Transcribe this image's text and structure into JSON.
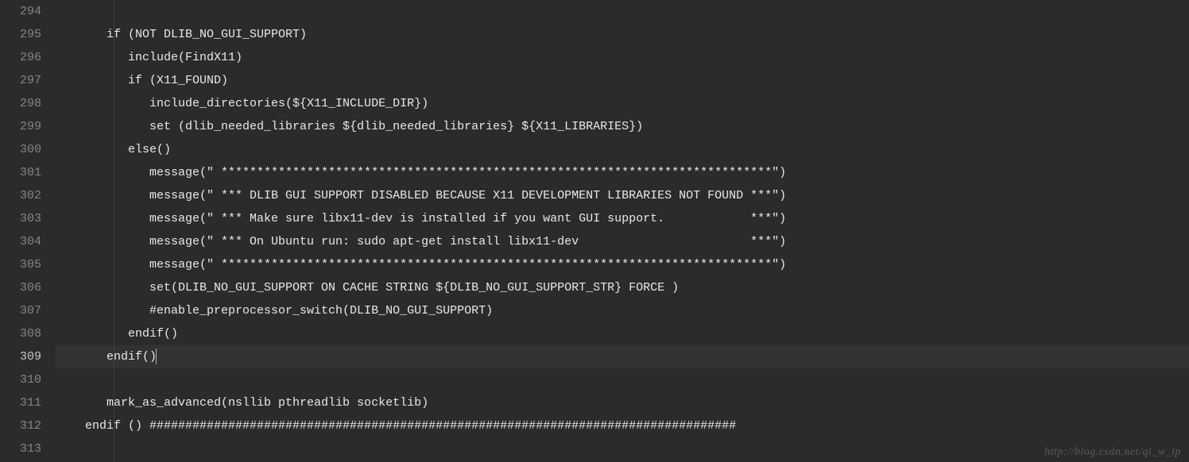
{
  "startLine": 294,
  "activeLine": 309,
  "lines": [
    "",
    "      if (NOT DLIB_NO_GUI_SUPPORT)",
    "         include(FindX11)",
    "         if (X11_FOUND)",
    "            include_directories(${X11_INCLUDE_DIR})",
    "            set (dlib_needed_libraries ${dlib_needed_libraries} ${X11_LIBRARIES})",
    "         else()",
    "            message(\" *****************************************************************************\")",
    "            message(\" *** DLIB GUI SUPPORT DISABLED BECAUSE X11 DEVELOPMENT LIBRARIES NOT FOUND ***\")",
    "            message(\" *** Make sure libx11-dev is installed if you want GUI support.            ***\")",
    "            message(\" *** On Ubuntu run: sudo apt-get install libx11-dev                        ***\")",
    "            message(\" *****************************************************************************\")",
    "            set(DLIB_NO_GUI_SUPPORT ON CACHE STRING ${DLIB_NO_GUI_SUPPORT_STR} FORCE )",
    "            #enable_preprocessor_switch(DLIB_NO_GUI_SUPPORT)",
    "         endif()",
    "      endif()",
    "",
    "      mark_as_advanced(nsllib pthreadlib socketlib)",
    "   endif () ##################################################################################",
    ""
  ],
  "watermark": "http://blog.csdn.net/qi_w_ip"
}
